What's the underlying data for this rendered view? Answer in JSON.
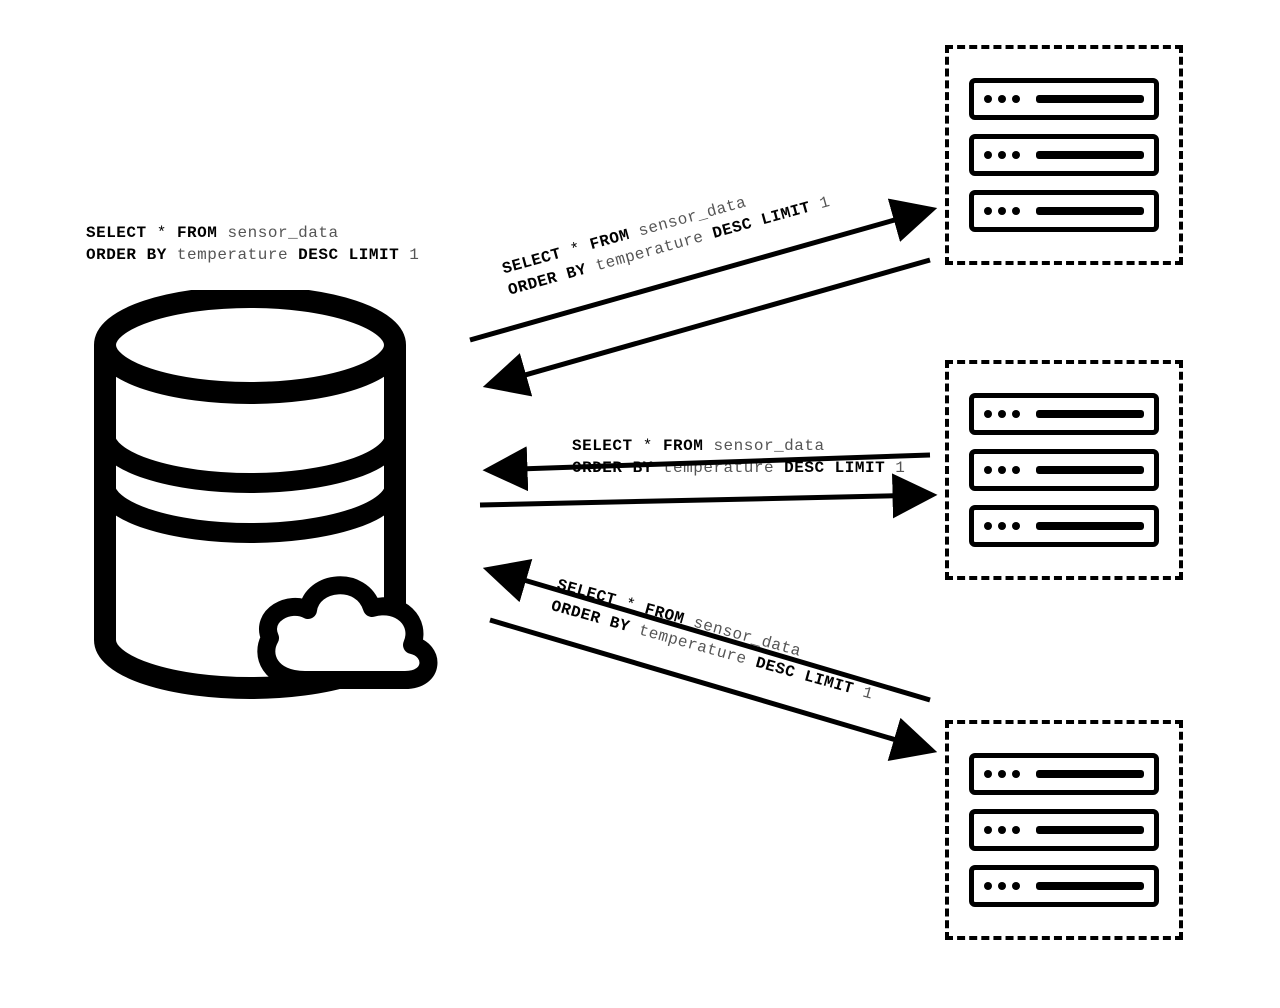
{
  "diagram": {
    "title": "Cloud database fan-out query to distributed server nodes",
    "query": {
      "select_kw": "SELECT",
      "star": "*",
      "from_kw": "FROM",
      "table": "sensor_data",
      "order_kw": "ORDER BY",
      "column": "temperature",
      "desc_kw": "DESC LIMIT",
      "limit_n": "1"
    },
    "labels": {
      "db": "Query shown over cloud database",
      "top": "Query sent to server rack 1",
      "mid": "Query sent to server rack 2",
      "bot": "Query sent to server rack 3"
    },
    "nodes": {
      "database": "cloud-database",
      "racks": [
        "server-rack-1",
        "server-rack-2",
        "server-rack-3"
      ],
      "units_per_rack": 3
    },
    "connections": [
      {
        "from": "cloud-database",
        "to": "server-rack-1",
        "bidirectional": true
      },
      {
        "from": "cloud-database",
        "to": "server-rack-2",
        "bidirectional": true
      },
      {
        "from": "cloud-database",
        "to": "server-rack-3",
        "bidirectional": true
      }
    ]
  }
}
